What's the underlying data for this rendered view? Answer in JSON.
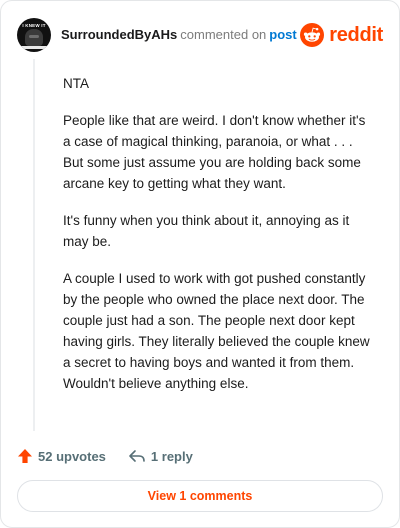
{
  "header": {
    "avatar_caption": "I KNEW IT",
    "username": "SurroundedByAHs",
    "action_text": "commented on",
    "post_link": "post",
    "brand": "reddit"
  },
  "comment": {
    "paragraphs": [
      "NTA",
      "People like that are weird. I don't know whether it's a case of magical thinking, paranoia, or what . . . But some just assume you are holding back some arcane key to getting what they want.",
      "It's funny when you think about it, annoying as it may be.",
      "A couple I used to work with got pushed constantly by the people who owned the place next door. The couple just had a son. The people next door kept having girls. They literally believed the couple knew a secret to having boys and wanted it from them. Wouldn't believe anything else."
    ]
  },
  "actions": {
    "upvotes_label": "52 upvotes",
    "reply_label": "1 reply",
    "upvote_icon": "upvote-arrow-icon",
    "reply_icon": "reply-arrow-icon"
  },
  "footer": {
    "view_comments_label": "View 1 comments"
  },
  "colors": {
    "brand_orange": "#ff4500",
    "link_blue": "#0079d3",
    "muted_text": "#576f76"
  }
}
